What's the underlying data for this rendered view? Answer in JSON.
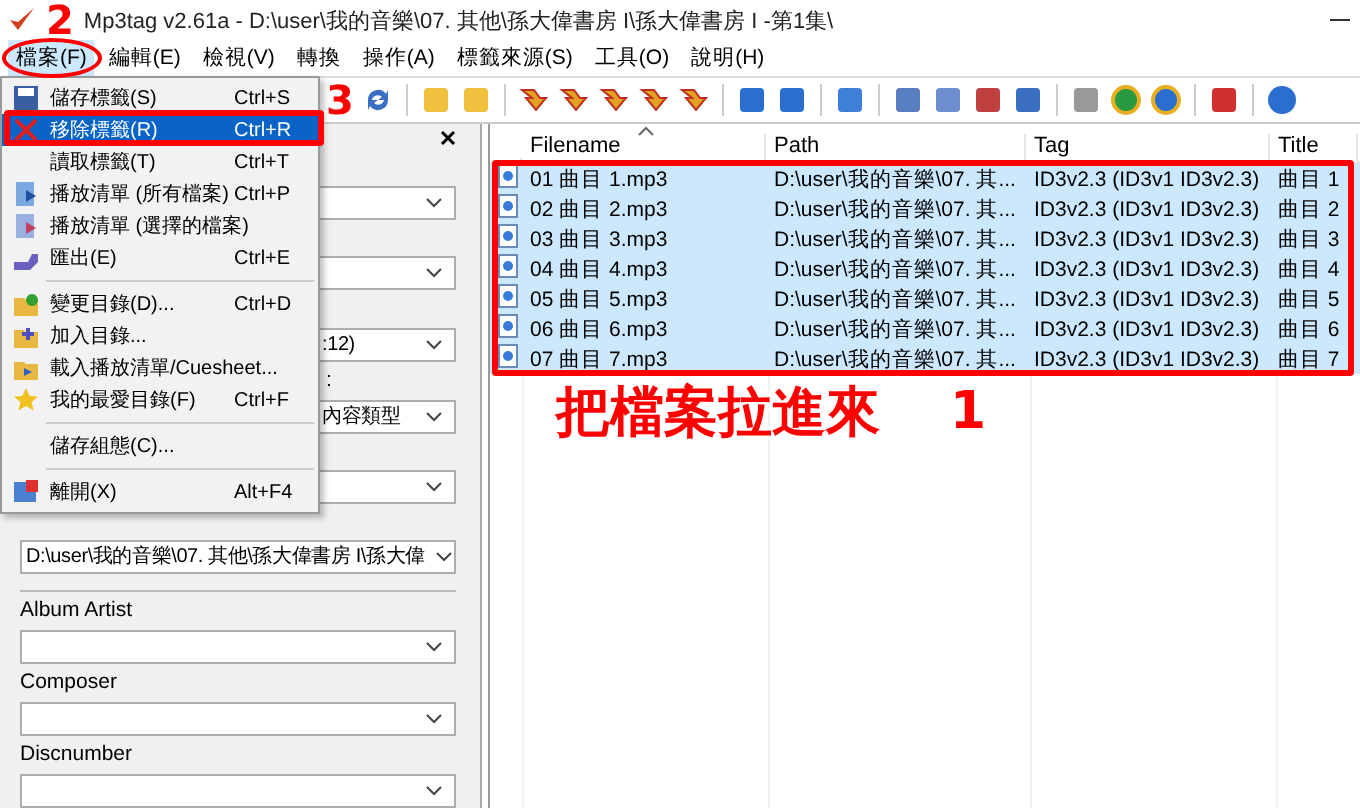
{
  "window": {
    "title": "Mp3tag v2.61a  -  D:\\user\\我的音樂\\07. 其他\\孫大偉書房 I\\孫大偉書房 I -第1集\\"
  },
  "menu_bar": [
    {
      "label": "檔案(F)",
      "selected": true
    },
    {
      "label": "編輯(E)",
      "selected": false
    },
    {
      "label": "檢視(V)",
      "selected": false
    },
    {
      "label": "轉換",
      "selected": false
    },
    {
      "label": "操作(A)",
      "selected": false
    },
    {
      "label": "標籤來源(S)",
      "selected": false
    },
    {
      "label": "工具(O)",
      "selected": false
    },
    {
      "label": "說明(H)",
      "selected": false
    }
  ],
  "file_menu": [
    {
      "kind": "item",
      "label": "儲存標籤(S)",
      "shortcut": "Ctrl+S",
      "selected": false
    },
    {
      "kind": "item",
      "label": "移除標籤(R)",
      "shortcut": "Ctrl+R",
      "selected": true
    },
    {
      "kind": "item",
      "label": "讀取標籤(T)",
      "shortcut": "Ctrl+T",
      "selected": false
    },
    {
      "kind": "item",
      "label": "播放清單 (所有檔案)",
      "shortcut": "Ctrl+P",
      "selected": false
    },
    {
      "kind": "item",
      "label": "播放清單 (選擇的檔案)",
      "selected": false
    },
    {
      "kind": "item",
      "label": "匯出(E)",
      "shortcut": "Ctrl+E",
      "selected": false
    },
    {
      "kind": "separator"
    },
    {
      "kind": "item",
      "label": "變更目錄(D)...",
      "shortcut": "Ctrl+D",
      "selected": false
    },
    {
      "kind": "item",
      "label": "加入目錄...",
      "selected": false
    },
    {
      "kind": "item",
      "label": "載入播放清單/Cuesheet...",
      "selected": false
    },
    {
      "kind": "item",
      "label": "我的最愛目錄(F)",
      "shortcut": "Ctrl+F",
      "selected": false
    },
    {
      "kind": "separator"
    },
    {
      "kind": "item",
      "label": "儲存組態(C)...",
      "selected": false
    },
    {
      "kind": "separator"
    },
    {
      "kind": "item",
      "label": "離開(X)",
      "shortcut": "Alt+F4",
      "selected": false
    }
  ],
  "tag_panel": {
    "fields": [
      {
        "covered": true
      },
      {
        "covered": true
      },
      {
        "covered": true,
        "value": ":12)"
      },
      {
        "covered": true,
        "label": ":",
        "value": "內容類型"
      },
      {
        "covered": true
      },
      {
        "value": "D:\\user\\我的音樂\\07. 其他\\孫大偉書房 I\\孫大偉"
      },
      {
        "label": "Album Artist",
        "separator_before": true
      },
      {
        "label": "Composer"
      },
      {
        "label": "Discnumber"
      }
    ]
  },
  "file_list": {
    "columns": [
      "Filename",
      "Path",
      "Tag",
      "Title"
    ],
    "rows": [
      {
        "filename": "01 曲目 1.mp3",
        "path": "D:\\user\\我的音樂\\07. 其...",
        "tag": "ID3v2.3 (ID3v1 ID3v2.3)",
        "title": "曲目 1",
        "selected": true
      },
      {
        "filename": "02 曲目 2.mp3",
        "path": "D:\\user\\我的音樂\\07. 其...",
        "tag": "ID3v2.3 (ID3v1 ID3v2.3)",
        "title": "曲目 2",
        "selected": true
      },
      {
        "filename": "03 曲目 3.mp3",
        "path": "D:\\user\\我的音樂\\07. 其...",
        "tag": "ID3v2.3 (ID3v1 ID3v2.3)",
        "title": "曲目 3",
        "selected": true
      },
      {
        "filename": "04 曲目 4.mp3",
        "path": "D:\\user\\我的音樂\\07. 其...",
        "tag": "ID3v2.3 (ID3v1 ID3v2.3)",
        "title": "曲目 4",
        "selected": true
      },
      {
        "filename": "05 曲目 5.mp3",
        "path": "D:\\user\\我的音樂\\07. 其...",
        "tag": "ID3v2.3 (ID3v1 ID3v2.3)",
        "title": "曲目 5",
        "selected": true
      },
      {
        "filename": "06 曲目 6.mp3",
        "path": "D:\\user\\我的音樂\\07. 其...",
        "tag": "ID3v2.3 (ID3v1 ID3v2.3)",
        "title": "曲目 6",
        "selected": true
      },
      {
        "filename": "07 曲目 7.mp3",
        "path": "D:\\user\\我的音樂\\07. 其...",
        "tag": "ID3v2.3 (ID3v1 ID3v2.3)",
        "title": "曲目 7",
        "selected": true
      }
    ]
  },
  "annotations": {
    "step_1": "1",
    "step_2": "2",
    "step_3": "3",
    "caption": "把檔案拉進來"
  }
}
